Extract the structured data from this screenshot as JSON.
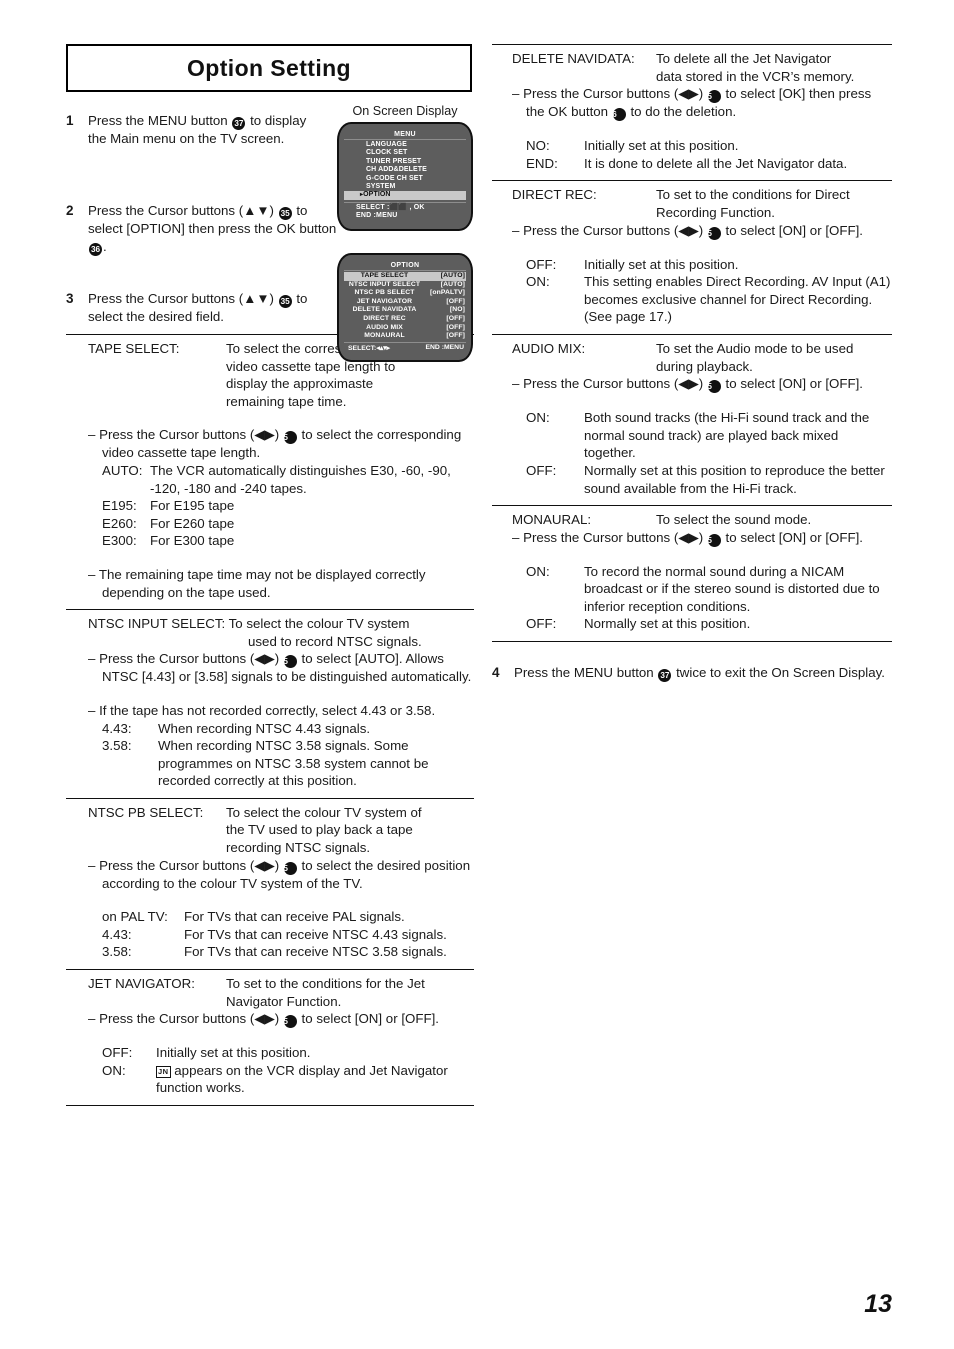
{
  "page": {
    "title": "Option  Setting",
    "number": "13"
  },
  "steps": [
    {
      "num": "1",
      "parts": [
        "Press the MENU button ",
        "37",
        " to display the Main menu on the TV screen."
      ]
    },
    {
      "num": "2",
      "parts": [
        "Press the Cursor buttons (▲▼) ",
        "35",
        " to select [OPTION] then press the OK button ",
        "36",
        "."
      ]
    },
    {
      "num": "3",
      "parts": [
        "Press the Cursor buttons (▲▼) ",
        "35",
        " to select the desired field."
      ]
    }
  ],
  "step4": {
    "num": "4",
    "text_before": "Press the MENU button ",
    "badge": "37",
    "text_after": " twice to exit the On Screen Display."
  },
  "osd": {
    "caption": "On Screen Display",
    "menu": {
      "title": "MENU",
      "items": [
        "LANGUAGE",
        "CLOCK SET",
        "TUNER PRESET",
        "CH ADD&DELETE",
        "G-CODE CH SET",
        "SYSTEM"
      ],
      "selected_item": "OPTION",
      "caret": "▸",
      "footer": [
        "SELECT :⬛⬛ , OK",
        "END      :MENU"
      ]
    },
    "option": {
      "title": "OPTION",
      "rows": [
        {
          "label": "TAPE SELECT",
          "value": "[AUTO]",
          "selected": true
        },
        {
          "label": "NTSC INPUT SELECT",
          "value": "[AUTO]",
          "selected": false
        },
        {
          "label": "NTSC PB SELECT",
          "value": "[onPALTV]",
          "selected": false
        },
        {
          "label": "JET NAVIGATOR",
          "value": "[OFF]",
          "selected": false
        },
        {
          "label": "DELETE NAVIDATA",
          "value": "[NO]",
          "selected": false
        },
        {
          "label": "DIRECT REC",
          "value": "[OFF]",
          "selected": false
        },
        {
          "label": "AUDIO MIX",
          "value": "[OFF]",
          "selected": false
        },
        {
          "label": "MONAURAL",
          "value": "[OFF]",
          "selected": false
        }
      ],
      "footer_left": "SELECT:◂▴▾▸",
      "footer_right": "END :MENU"
    }
  },
  "left_sections": {
    "tape_select": {
      "label": "TAPE SELECT:",
      "desc_lines": [
        "To select the corresponding",
        "video cassette tape length to",
        "display the approximaste",
        "remaining tape time."
      ],
      "bullet1_a": "– Press the Cursor buttons (◀▶) ",
      "bullet1_badge": "35",
      "bullet1_b": " to select the corresponding video cassette tape length.",
      "options": [
        {
          "k": "AUTO:",
          "v": "The VCR automatically distinguishes E30, -60, -90, -120, -180 and -240 tapes."
        },
        {
          "k": "E195:",
          "v": "For E195 tape"
        },
        {
          "k": "E260:",
          "v": "For E260 tape"
        },
        {
          "k": "E300:",
          "v": "For E300 tape"
        }
      ],
      "bullet2": "– The remaining tape time may not be displayed correctly depending on the tape used."
    },
    "ntsc_input_select": {
      "label": "NTSC INPUT SELECT:",
      "desc_line1": "To select the colour TV system",
      "desc_line2": "used to record NTSC signals.",
      "bullet1_a": "– Press the Cursor buttons (◀▶) ",
      "bullet1_badge": "35",
      "bullet1_b": " to select [AUTO]. Allows NTSC [4.43] or [3.58] signals to be distinguished automatically.",
      "bullet2": "– If the tape has not recorded correctly, select 4.43 or 3.58.",
      "options": [
        {
          "k": "4.43:",
          "v": "When recording NTSC 4.43 signals."
        },
        {
          "k": "3.58:",
          "v": "When recording NTSC 3.58 signals. Some programmes on NTSC 3.58 system cannot be recorded correctly at this position."
        }
      ]
    },
    "ntsc_pb_select": {
      "label": "NTSC PB SELECT:",
      "desc_lines": [
        "To select the colour TV system of",
        "the TV used to play back a tape",
        "recording NTSC signals."
      ],
      "bullet1_a": "– Press the Cursor buttons (◀▶) ",
      "bullet1_badge": "35",
      "bullet1_b": " to select the desired position according to the colour TV system of the TV.",
      "options": [
        {
          "k": "on PAL TV:",
          "v": "For TVs that can receive PAL signals."
        },
        {
          "k": "4.43:",
          "v": "For TVs that can receive NTSC 4.43 signals."
        },
        {
          "k": "3.58:",
          "v": "For TVs that can receive NTSC 3.58 signals."
        }
      ]
    },
    "jet_navigator": {
      "label": "JET NAVIGATOR:",
      "desc_line1": "To set to the conditions for the Jet",
      "desc_line2": "Navigator Function.",
      "bullet1_a": "– Press the Cursor buttons (◀▶) ",
      "bullet1_badge": "35",
      "bullet1_b": " to select [ON] or [OFF].",
      "options": [
        {
          "k": "OFF:",
          "v": "Initially set at this position."
        }
      ],
      "on_label": "ON:",
      "on_icon": "JN",
      "on_text": " appears on the VCR display and Jet Navigator function works."
    }
  },
  "right_sections": {
    "delete_navidata": {
      "label": "DELETE NAVIDATA:",
      "desc_line1": "To delete all the Jet Navigator",
      "desc_line2": "data stored in the VCR’s memory.",
      "bullet1_a": "– Press the Cursor buttons (◀▶) ",
      "bullet1_badge": "35",
      "bullet1_b": " to select [OK] then press the OK button ",
      "bullet1_badge2": "36",
      "bullet1_c": " to do the deletion.",
      "options": [
        {
          "k": "NO:",
          "v": "Initially set at this position."
        },
        {
          "k": "END:",
          "v": "It is done to delete all the Jet Navigator data."
        }
      ]
    },
    "direct_rec": {
      "label": "DIRECT REC:",
      "desc_line1": "To set to the conditions for Direct",
      "desc_line2": "Recording Function.",
      "bullet1_a": "– Press the Cursor buttons (◀▶) ",
      "bullet1_badge": "35",
      "bullet1_b": " to select [ON] or [OFF].",
      "options": [
        {
          "k": "OFF:",
          "v": "Initially set at this position."
        },
        {
          "k": "ON:",
          "v": "This setting enables Direct Recording. AV Input (A1) becomes exclusive channel for Direct Recording. (See page 17.)"
        }
      ]
    },
    "audio_mix": {
      "label": "AUDIO MIX:",
      "desc_line1": "To set the Audio mode to be used",
      "desc_line2": "during playback.",
      "bullet1_a": "– Press the Cursor buttons (◀▶) ",
      "bullet1_badge": "35",
      "bullet1_b": " to select [ON] or [OFF].",
      "options": [
        {
          "k": "ON:",
          "v": "Both sound tracks (the Hi-Fi sound track and the normal sound track) are played back mixed together."
        },
        {
          "k": "OFF:",
          "v": "Normally set at this position to reproduce the better sound available from the Hi-Fi track."
        }
      ]
    },
    "monaural": {
      "label": "MONAURAL:",
      "desc_line1": "To select the sound mode.",
      "bullet1_a": "– Press the Cursor buttons (◀▶) ",
      "bullet1_badge": "35",
      "bullet1_b": " to select [ON] or [OFF].",
      "options": [
        {
          "k": "ON:",
          "v": "To record the normal sound during a NICAM broadcast or if the stereo sound is distorted due to inferior reception conditions."
        },
        {
          "k": "OFF:",
          "v": "Normally set at this position."
        }
      ]
    }
  }
}
